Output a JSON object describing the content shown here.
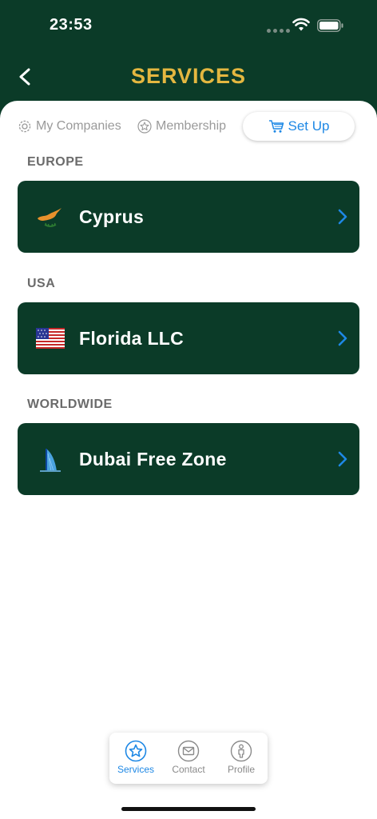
{
  "status_bar": {
    "time": "23:53"
  },
  "header": {
    "title": "SERVICES",
    "back_icon": "chevron-left-icon"
  },
  "tabs": [
    {
      "label": "My Companies",
      "icon": "gear-icon",
      "active": false
    },
    {
      "label": "Membership",
      "icon": "star-icon",
      "active": false
    },
    {
      "label": "Set Up",
      "icon": "cart-icon",
      "active": true
    }
  ],
  "sections": [
    {
      "label": "EUROPE",
      "items": [
        {
          "label": "Cyprus",
          "icon": "cyprus-flag-icon"
        }
      ]
    },
    {
      "label": "USA",
      "items": [
        {
          "label": "Florida LLC",
          "icon": "us-flag-icon"
        }
      ]
    },
    {
      "label": "WORLDWIDE",
      "items": [
        {
          "label": "Dubai Free Zone",
          "icon": "burj-al-arab-icon"
        }
      ]
    }
  ],
  "bottom_nav": [
    {
      "label": "Services",
      "icon": "star-icon",
      "active": true
    },
    {
      "label": "Contact",
      "icon": "mail-icon",
      "active": false
    },
    {
      "label": "Profile",
      "icon": "person-icon",
      "active": false
    }
  ],
  "colors": {
    "primary_green": "#0b3b28",
    "title_gold": "#e4b740",
    "accent_blue": "#1e88e5",
    "section_gray": "#6b6b6b"
  }
}
